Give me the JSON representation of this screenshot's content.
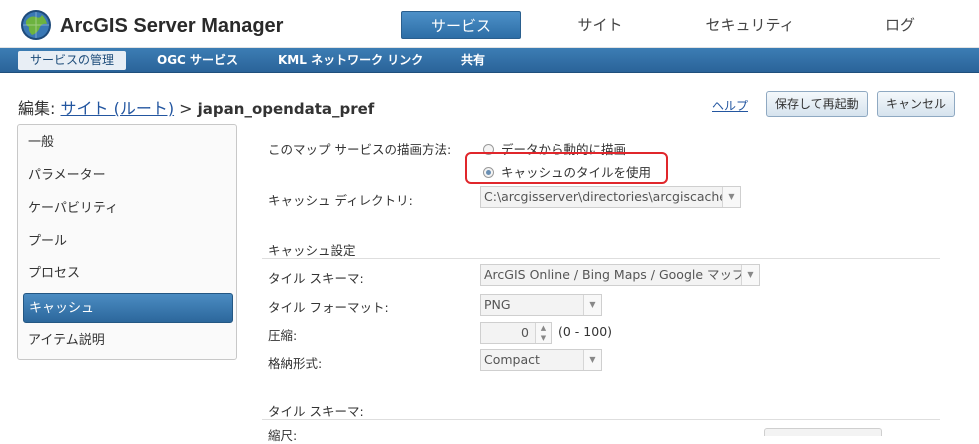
{
  "header": {
    "app_title": "ArcGIS Server Manager",
    "nav": [
      {
        "label": "サービス",
        "active": true
      },
      {
        "label": "サイト",
        "active": false
      },
      {
        "label": "セキュリティ",
        "active": false
      },
      {
        "label": "ログ",
        "active": false
      }
    ]
  },
  "subnav": {
    "items": [
      {
        "label": "サービスの管理",
        "active": true
      },
      {
        "label": "OGC サービス",
        "active": false
      },
      {
        "label": "KML ネットワーク リンク",
        "active": false
      },
      {
        "label": "共有",
        "active": false
      }
    ]
  },
  "title_bar": {
    "prefix": "編集: ",
    "crumb_link": "サイト (ルート)",
    "separator": " > ",
    "service_name": "japan_opendata_pref",
    "help": "ヘルプ",
    "save_button": "保存して再起動",
    "cancel_button": "キャンセル"
  },
  "sidebar": {
    "items": [
      {
        "label": "一般",
        "active": false
      },
      {
        "label": "パラメーター",
        "active": false
      },
      {
        "label": "ケーパビリティ",
        "active": false
      },
      {
        "label": "プール",
        "active": false
      },
      {
        "label": "プロセス",
        "active": false
      },
      {
        "label": "キャッシュ",
        "active": true
      },
      {
        "label": "アイテム説明",
        "active": false
      }
    ]
  },
  "form": {
    "draw_method_label": "このマップ サービスの描画方法:",
    "radio_dynamic": "データから動的に描画",
    "radio_cache": "キャッシュのタイルを使用",
    "selected_radio": "radio_cache",
    "cache_dir_label": "キャッシュ ディレクトリ:",
    "cache_dir_value": "C:\\arcgisserver\\directories\\arcgiscache",
    "cache_settings_title": "キャッシュ設定",
    "tile_scheme_label": "タイル スキーマ:",
    "tile_scheme_value": "ArcGIS Online / Bing Maps / Google マップ",
    "tile_format_label": "タイル フォーマット:",
    "tile_format_value": "PNG",
    "compression_label": "圧縮:",
    "compression_value": "0",
    "compression_range": "(0 - 100)",
    "storage_label": "格納形式:",
    "storage_value": "Compact",
    "tile_scheme_section_title": "タイル スキーマ:",
    "scale_label": "縮尺:"
  },
  "colors": {
    "accent": "#3e80b7",
    "highlight": "#e0262b"
  }
}
